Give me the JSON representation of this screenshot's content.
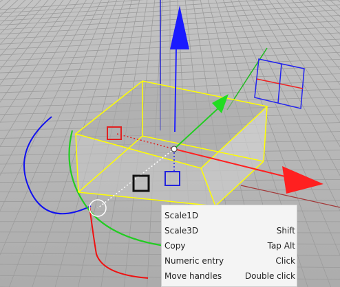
{
  "scene": {
    "colors": {
      "background": "#b8b8b8",
      "grid": "#9e9e9e",
      "box_edge": "#ffff00",
      "axis_x": "#ff2020",
      "axis_y": "#22cc22",
      "axis_z": "#1010ff"
    }
  },
  "context_menu": {
    "items": [
      {
        "label": "Scale1D",
        "shortcut": ""
      },
      {
        "label": "Scale3D",
        "shortcut": "Shift"
      },
      {
        "label": "Copy",
        "shortcut": "Tap Alt"
      },
      {
        "label": "Numeric entry",
        "shortcut": "Click"
      },
      {
        "label": "Move handles",
        "shortcut": "Double click"
      }
    ]
  }
}
